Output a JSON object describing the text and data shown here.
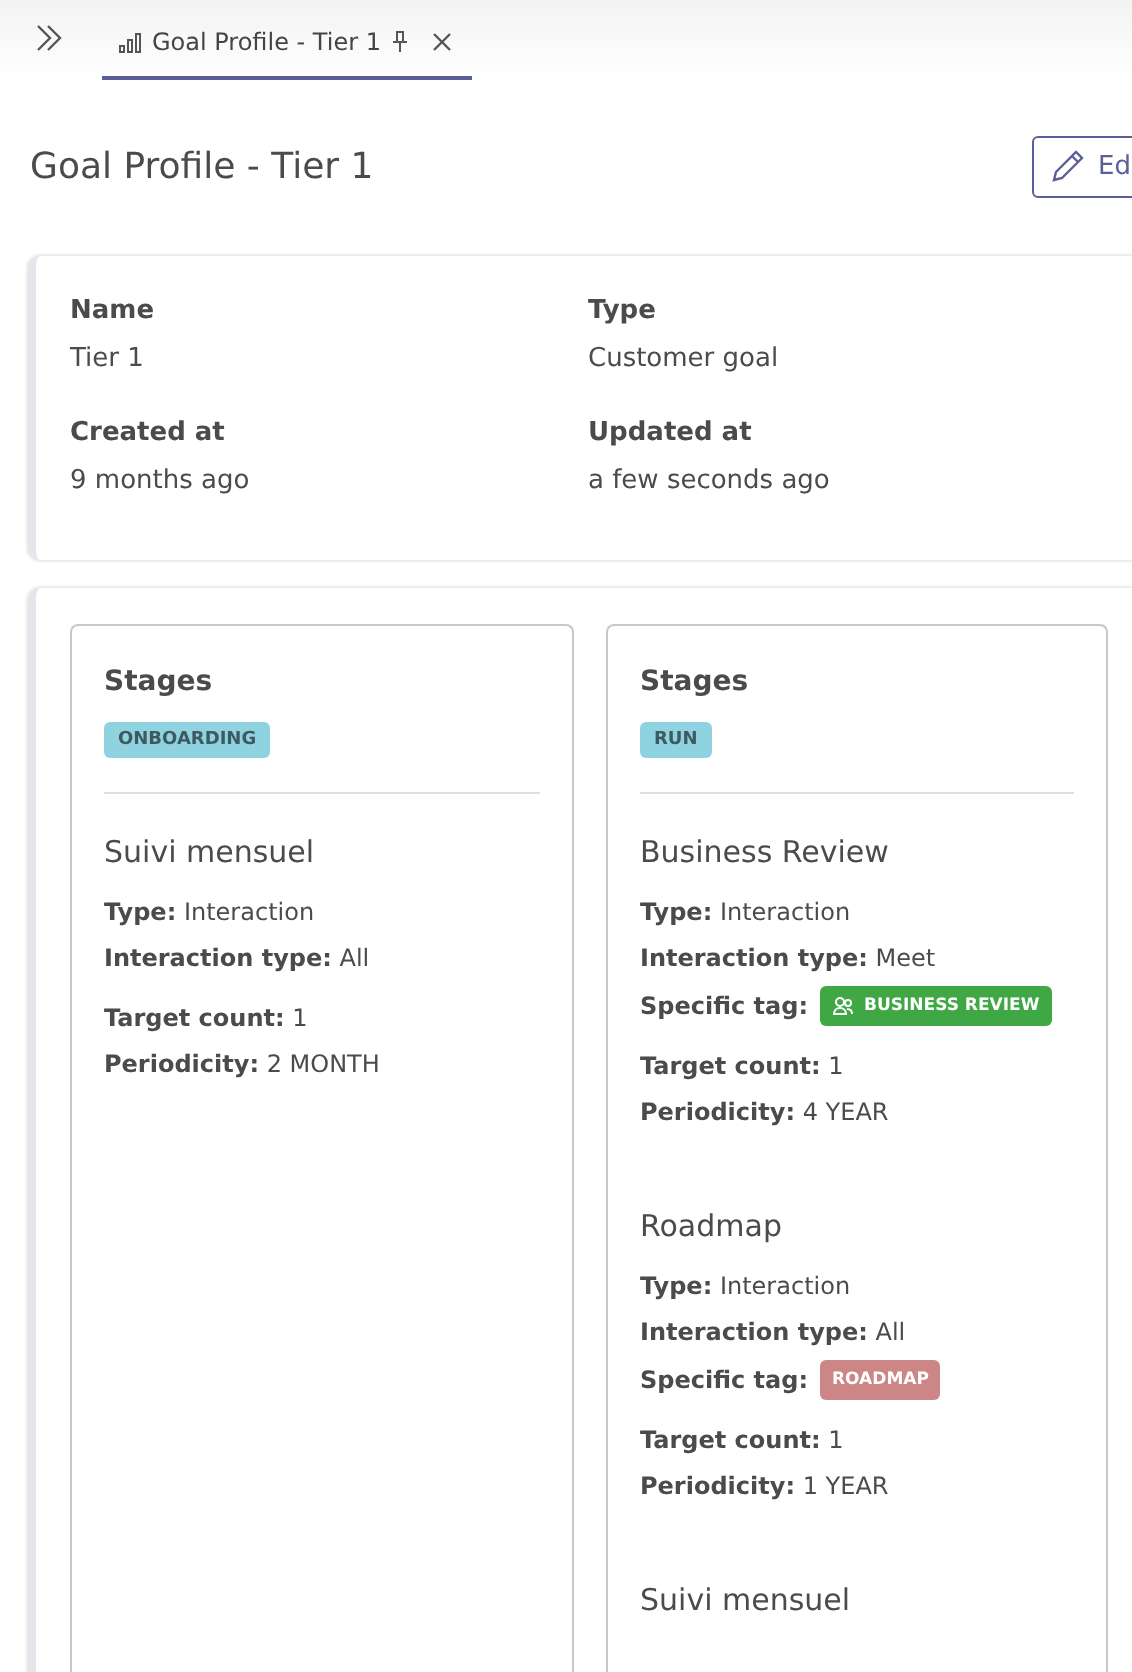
{
  "tabs": [
    {
      "label": "Goal Profile - Tier 1",
      "selected": true
    }
  ],
  "header": {
    "title": "Goal Profile - Tier 1",
    "edit_button": "Ed"
  },
  "details": [
    {
      "label": "Name",
      "value": "Tier 1"
    },
    {
      "label": "Type",
      "value": "Customer goal"
    },
    {
      "label": "Created at",
      "value": "9 months ago"
    },
    {
      "label": "Updated at",
      "value": "a few seconds ago"
    }
  ],
  "stages": [
    {
      "heading": "Stages",
      "stage": {
        "label": "ONBOARDING",
        "color": "#8fd3e0"
      },
      "goals": [
        {
          "title": "Suivi mensuel",
          "details": [
            {
              "label": "Type:",
              "value": "Interaction"
            },
            {
              "label": "Interaction type:",
              "value": "All"
            }
          ],
          "targets": [
            {
              "label": "Target count:",
              "value": "1"
            },
            {
              "label": "Periodicity:",
              "value": "2 MONTH"
            }
          ]
        }
      ]
    },
    {
      "heading": "Stages",
      "stage": {
        "label": "RUN",
        "color": "#8fd3e0"
      },
      "goals": [
        {
          "title": "Business Review",
          "details": [
            {
              "label": "Type:",
              "value": "Interaction"
            },
            {
              "label": "Interaction type:",
              "value": "Meet"
            }
          ],
          "tag": {
            "prefix": "Specific tag:",
            "label": "BUSINESS REVIEW",
            "color": "#3fa845",
            "kind": "people"
          },
          "targets": [
            {
              "label": "Target count:",
              "value": "1"
            },
            {
              "label": "Periodicity:",
              "value": "4 YEAR"
            }
          ]
        },
        {
          "title": "Roadmap",
          "details": [
            {
              "label": "Type:",
              "value": "Interaction"
            },
            {
              "label": "Interaction type:",
              "value": "All"
            }
          ],
          "tag": {
            "prefix": "Specific tag:",
            "label": "ROADMAP",
            "color": "#cc8686",
            "kind": "plain"
          },
          "targets": [
            {
              "label": "Target count:",
              "value": "1"
            },
            {
              "label": "Periodicity:",
              "value": "1 YEAR"
            }
          ]
        },
        {
          "title": "Suivi mensuel"
        }
      ]
    }
  ]
}
